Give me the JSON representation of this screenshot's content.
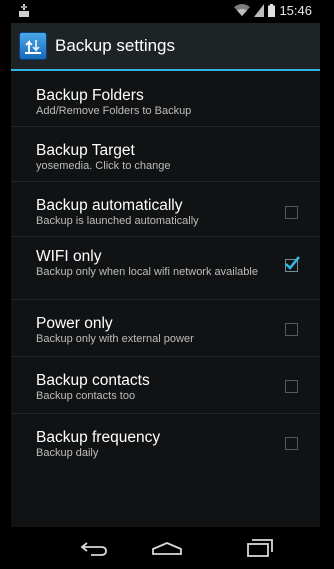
{
  "status_bar": {
    "time": "15:46"
  },
  "action_bar": {
    "title": "Backup settings"
  },
  "settings": [
    {
      "title": "Backup Folders",
      "summary": "Add/Remove Folders to Backup",
      "checkbox": null
    },
    {
      "title": "Backup Target",
      "summary": "yosemedia. Click to change",
      "checkbox": null
    },
    {
      "title": "Backup automatically",
      "summary": "Backup is launched automatically",
      "checkbox": false
    },
    {
      "title": "WIFI only",
      "summary": "Backup only when local wifi network available",
      "checkbox": true
    },
    {
      "title": "Power only",
      "summary": "Backup only with external power",
      "checkbox": false
    },
    {
      "title": "Backup contacts",
      "summary": "Backup contacts too",
      "checkbox": false
    },
    {
      "title": "Backup frequency",
      "summary": "Backup daily",
      "checkbox": false
    }
  ],
  "colors": {
    "accent": "#33b5e5",
    "background": "#101214",
    "checkmark": "#33b5e5"
  },
  "icons": {
    "notification": "download-notification-icon",
    "wifi": "wifi-icon",
    "signal": "signal-icon",
    "battery": "battery-icon",
    "app": "backup-app-icon",
    "back": "back-icon",
    "home": "home-icon",
    "recents": "recents-icon"
  }
}
